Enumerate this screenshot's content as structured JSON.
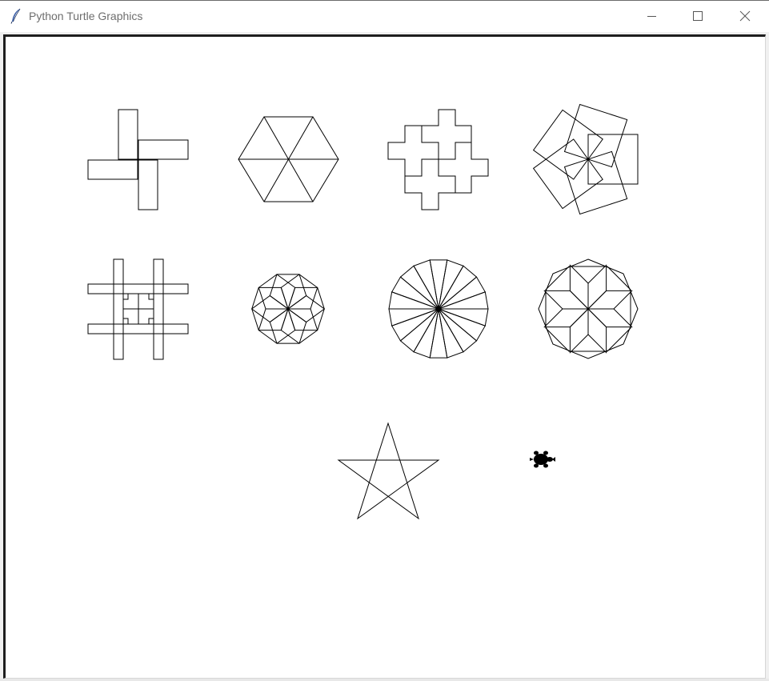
{
  "window": {
    "title": "Python Turtle Graphics",
    "app_icon": "feather-icon",
    "controls": {
      "minimize_icon": "minimize-icon",
      "maximize_icon": "maximize-icon",
      "close_icon": "close-icon"
    }
  },
  "canvas": {
    "background": "#ffffff",
    "pen_color": "#000000",
    "drawings": [
      "pinwheel-rectangles",
      "hexagon-with-diagonals",
      "plus-cluster",
      "rotated-squares",
      "hash-grid",
      "rotated-pentagons",
      "radiating-triangles",
      "octagon-rosette",
      "five-point-star"
    ],
    "cursor_icon": "turtle-icon"
  }
}
